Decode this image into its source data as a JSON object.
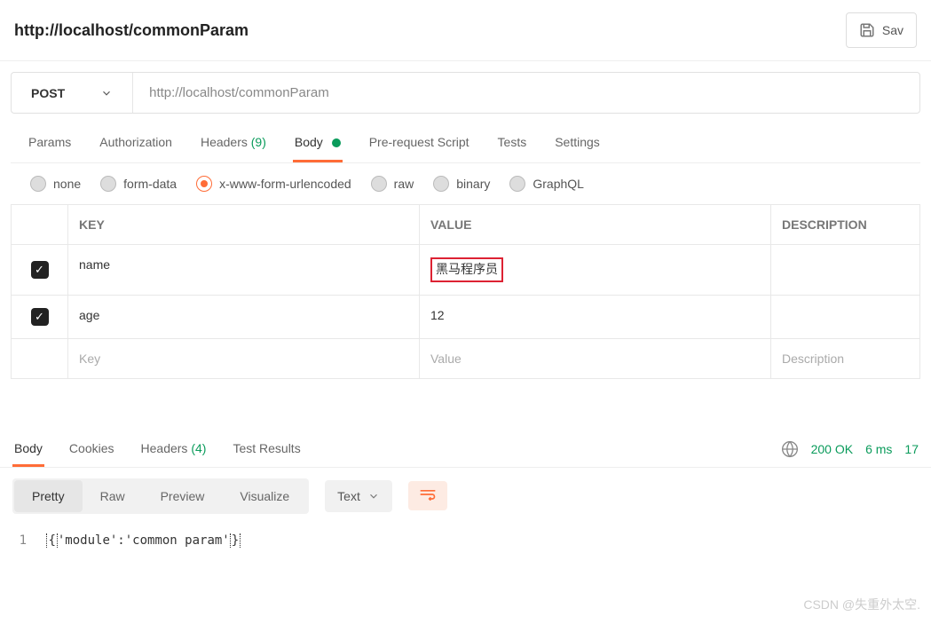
{
  "header": {
    "title": "http://localhost/commonParam",
    "save_label": "Sav"
  },
  "request": {
    "method": "POST",
    "url": "http://localhost/commonParam"
  },
  "tabs": {
    "params": "Params",
    "authorization": "Authorization",
    "headers_label": "Headers",
    "headers_count": "(9)",
    "body": "Body",
    "prereq": "Pre-request Script",
    "tests": "Tests",
    "settings": "Settings"
  },
  "body_types": {
    "none": "none",
    "formdata": "form-data",
    "urlencoded": "x-www-form-urlencoded",
    "raw": "raw",
    "binary": "binary",
    "graphql": "GraphQL"
  },
  "kv": {
    "headers": {
      "key": "KEY",
      "value": "VALUE",
      "desc": "DESCRIPTION"
    },
    "rows": [
      {
        "key": "name",
        "value": "黑马程序员",
        "desc": "",
        "hl": true
      },
      {
        "key": "age",
        "value": "12",
        "desc": "",
        "hl": false
      }
    ],
    "placeholder": {
      "key": "Key",
      "value": "Value",
      "desc": "Description"
    }
  },
  "response": {
    "tabs": {
      "body": "Body",
      "cookies": "Cookies",
      "headers_label": "Headers",
      "headers_count": "(4)",
      "results": "Test Results"
    },
    "status": {
      "code": "200 OK",
      "time": "6 ms",
      "size": "17"
    },
    "view": {
      "pretty": "Pretty",
      "raw": "Raw",
      "preview": "Preview",
      "visualize": "Visualize",
      "lang": "Text"
    },
    "code": {
      "line_no": "1",
      "text": "'module':'common param'"
    }
  },
  "watermark": "CSDN @失重外太空."
}
